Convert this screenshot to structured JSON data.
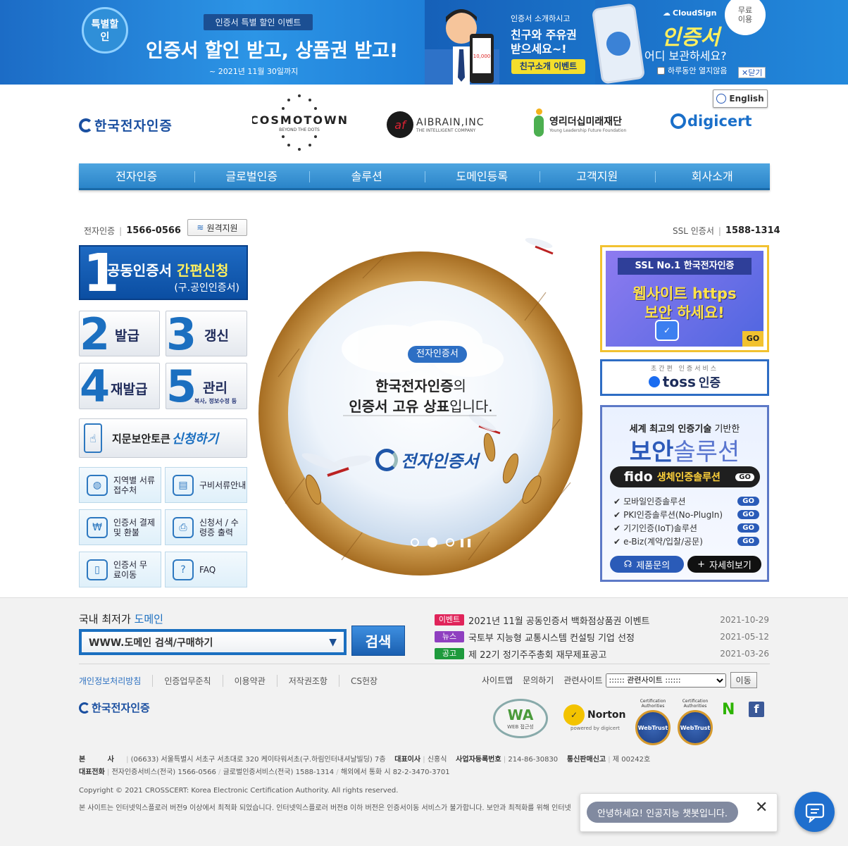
{
  "banners": {
    "event": {
      "badge": "특별할인",
      "subtitle": "인증서 특별 할인 이벤트",
      "headline": "인증서 할인 받고, 상품권 받고!",
      "date": "~ 2021년 11월 30일까지"
    },
    "referral": {
      "line1": "인증서 소개하시고",
      "line2": "친구와 주유권",
      "line3": "받으세요~!",
      "button": "친구소개 이벤트",
      "card_amount": "10,000"
    },
    "cloudsign": {
      "brand": "CloudSign",
      "title": "인증서",
      "subtitle": "어디 보관하세요?",
      "free_badge": "무료이용",
      "checkbox_label": "하루동안 열지않음",
      "close_label": "닫기"
    }
  },
  "header": {
    "logo_text": "한국전자인증",
    "english": "English",
    "partners": [
      {
        "name": "COSMOTOWN",
        "tagline": "BEYOND THE DOTS"
      },
      {
        "name": "AIBRAIN,INC",
        "tagline": "THE INTELLIGENT COMPANY"
      },
      {
        "name": "영리더십미래재단",
        "tagline": "Young Leadership Future Foundation"
      },
      {
        "name": "digicert"
      }
    ]
  },
  "nav": [
    "전자인증",
    "글로벌인증",
    "솔루션",
    "도메인등록",
    "고객지원",
    "회사소개"
  ],
  "left": {
    "phone_label": "전자인증",
    "phone": "1566-0566",
    "remote": "원격지원",
    "apply": {
      "num": "1",
      "title_a": "공동인증서",
      "title_b": "간편신청",
      "sub": "(구.공인인증서)"
    },
    "tiles": [
      {
        "num": "2",
        "label": "발급"
      },
      {
        "num": "3",
        "label": "갱신"
      },
      {
        "num": "4",
        "label": "재발급"
      },
      {
        "num": "5",
        "label": "관리",
        "sub": "복사, 정보수정 등"
      }
    ],
    "fingerprint": {
      "a": "지문보안토큰",
      "b": "신청하기"
    },
    "small": [
      {
        "label": "지역별 서류접수처",
        "icon": "globe-icon"
      },
      {
        "label": "구비서류안내",
        "icon": "document-lock-icon"
      },
      {
        "label": "인증서 결제 및 환불",
        "icon": "payment-icon"
      },
      {
        "label": "신청서 / 수령증 출력",
        "icon": "print-form-icon"
      },
      {
        "label": "인증서 무료이동",
        "icon": "mobile-transfer-icon"
      },
      {
        "label": "FAQ",
        "icon": "faq-icon"
      }
    ]
  },
  "center": {
    "badge": "전자인증서",
    "line1a": "한국전자인증",
    "line1b": "의",
    "line2a": "인증서 고유 상표",
    "line2b": "입니다.",
    "mark": "전자인증서"
  },
  "right": {
    "phone_label": "SSL 인증서",
    "phone": "1588-1314",
    "ssl": {
      "tag": "SSL No.1 한국전자인증",
      "line1": "웹사이트 https",
      "line2": "보안 하세요!",
      "go": "GO"
    },
    "toss": {
      "top": "초간편 인증서비스",
      "brand": "toss",
      "label": "인증"
    },
    "security": {
      "top_a": "세계 최고의 인증기술",
      "top_b": "기반한",
      "title_a": "보안",
      "title_b": "솔루션",
      "fido": "fido",
      "fido_label": "생체인증솔루션",
      "items": [
        "모바일인증솔루션",
        "PKI인증솔루션(No-PlugIn)",
        "기기인증(IoT)솔루션",
        "e-Biz(계약/입찰/공문)"
      ],
      "go": "GO",
      "inquiry": "제품문의",
      "more": "자세히보기"
    }
  },
  "footer": {
    "domain_title_a": "국내 최저가",
    "domain_title_b": "도메인",
    "search_value": "WWW.도메인 검색/구매하기",
    "search_btn": "검색",
    "news": [
      {
        "tag": "이벤트",
        "color": "#e0245a",
        "title": "2021년 11월 공동인증서 백화점상품권 이벤트",
        "date": "2021-10-29"
      },
      {
        "tag": "뉴스",
        "color": "#8f3fc0",
        "title": "국토부 지능형 교통시스템 컨설팅 기업 선정",
        "date": "2021-05-12"
      },
      {
        "tag": "공고",
        "color": "#1e9a3c",
        "title": "제 22기 정기주주총회 재무제표공고",
        "date": "2021-03-26"
      }
    ],
    "links": [
      "개인정보처리방침",
      "인증업무준칙",
      "이용약관",
      "저작권조항",
      "CS헌장"
    ],
    "sitemap": "사이트맵",
    "inquiry": "문의하기",
    "related_label": "관련사이트",
    "related_select": ":::::: 관련사이트 ::::::",
    "go_btn": "이동",
    "logo": "한국전자인증",
    "badges": [
      "WA",
      "Norton",
      "WebTrust",
      "WebTrust"
    ],
    "norton_sub": "powered by digicert",
    "wa_sub": "WEB 접근성",
    "cert_label": "Certification Authorities",
    "address_label": "본 사",
    "address": "(06633) 서울특별시 서초구 서초대로 320 케이타워서초(구.하림인터내셔날빌딩) 7층",
    "ceo_label": "대표이사",
    "ceo": "신홍식",
    "biz_label": "사업자등록번호",
    "biz": "214-86-30830",
    "mail_label": "통신판매신고",
    "mail": "제 00242호",
    "tel_label": "대표전화",
    "tel1": "전자인증서비스(전국) 1566-0566",
    "tel2": "글로벌인증서비스(전국) 1588-1314",
    "tel3": "해외에서 통화 시 82-2-3470-3701",
    "copyright": "Copyright © 2021 CROSSCERT: Korea Electronic Certification Authority. All rights reserved.",
    "notice": "본 사이트는 인터넷익스플로러 버전9 이상에서 최적화 되었습니다. 인터넷익스플로러 버전8 이하 버전은 인증서이동 서비스가 불가합니다. 보안과 최적화를 위해 인터넷"
  },
  "chat": {
    "greeting": "안녕하세요! 인공지능 챗봇입니다."
  }
}
